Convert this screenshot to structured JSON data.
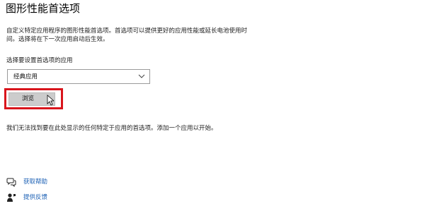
{
  "page": {
    "title": "图形性能首选项",
    "description": "自定义特定应用程序的图形性能首选项。首选项可以提供更好的应用性能或延长电池使用时间。选择将在下一次应用启动后生效。"
  },
  "app_selector": {
    "label": "选择要设置首选项的应用",
    "selected_value": "经典应用",
    "chevron_icon": "chevron-down-icon"
  },
  "browse": {
    "label": "浏览",
    "highlight_color": "#d9151c"
  },
  "info": {
    "message": "我们无法找到要在此处显示的任何特定于应用的首选项。添加一个应用以开始。"
  },
  "links": {
    "help": {
      "label": "获取帮助",
      "icon": "help-chat-icon"
    },
    "feedback": {
      "label": "提供反馈",
      "icon": "feedback-person-icon"
    },
    "color": "#1a5fb4"
  }
}
